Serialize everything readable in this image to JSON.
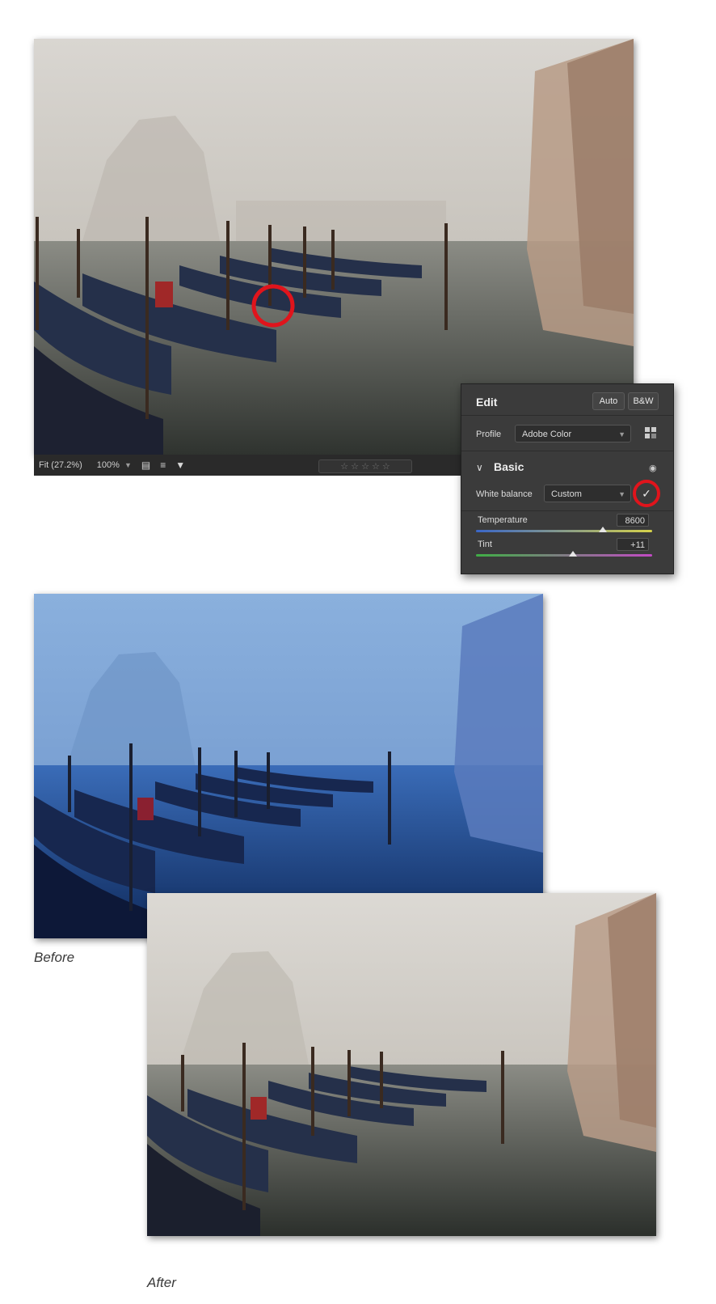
{
  "toolbar": {
    "fit_label": "Fit (27.2%)",
    "zoom_label": "100%",
    "stars": "☆ ☆ ☆ ☆ ☆"
  },
  "edit_panel": {
    "title": "Edit",
    "auto_label": "Auto",
    "bw_label": "B&W",
    "profile_label": "Profile",
    "profile_value": "Adobe Color",
    "section_title": "Basic",
    "white_balance_label": "White balance",
    "white_balance_value": "Custom",
    "temperature_label": "Temperature",
    "temperature_value": "8600",
    "temperature_position": 0.72,
    "tint_label": "Tint",
    "tint_value": "+11",
    "tint_position": 0.55
  },
  "captions": {
    "before": "Before",
    "after": "After"
  },
  "colors": {
    "highlight_ring": "#e0141c",
    "panel_bg": "#3b3b3b",
    "toolbar_bg": "#2a2a2a"
  }
}
